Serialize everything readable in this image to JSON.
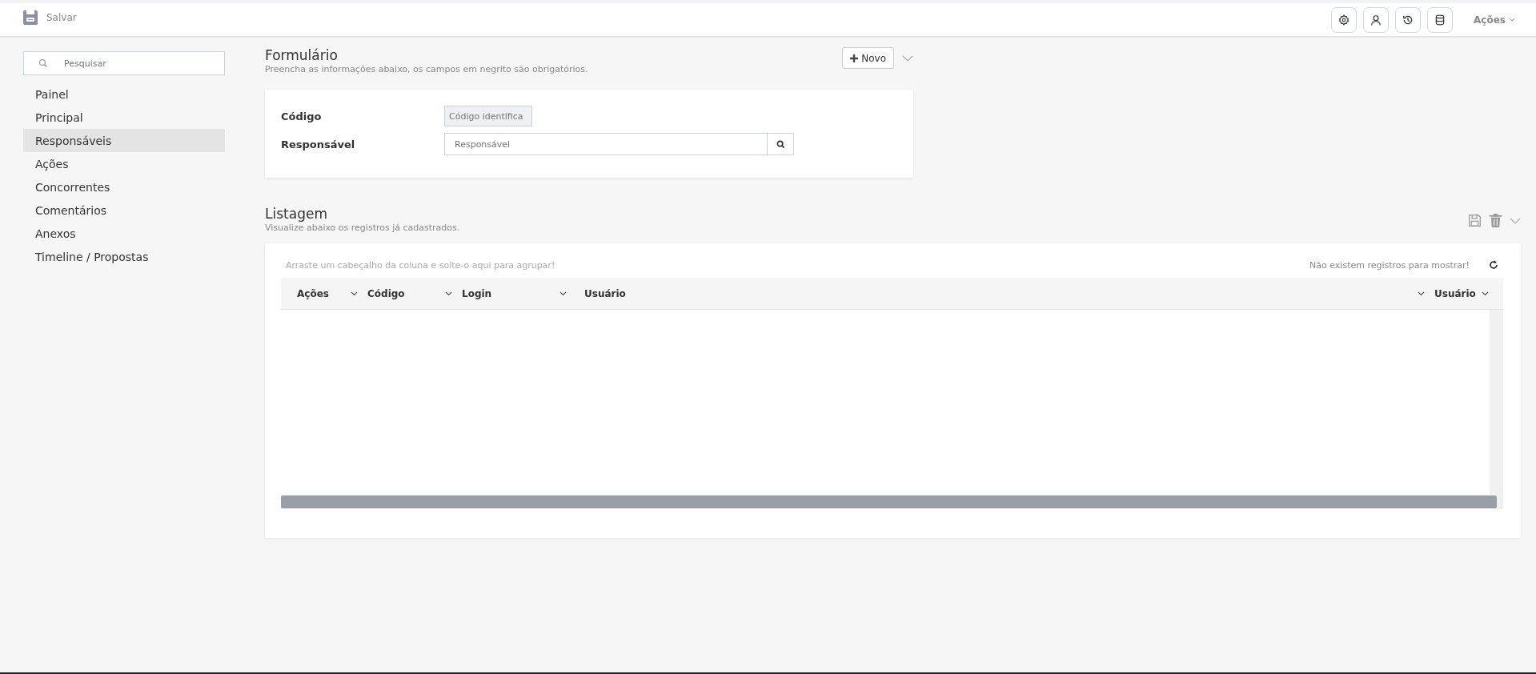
{
  "toolbar": {
    "save_label": "Salvar",
    "actions_label": "Ações"
  },
  "sidebar": {
    "search": {
      "placeholder": "Pesquisar"
    },
    "items": [
      {
        "label": "Painel",
        "selected": false
      },
      {
        "label": "Principal",
        "selected": false
      },
      {
        "label": "Responsáveis",
        "selected": true
      },
      {
        "label": "Ações",
        "selected": false
      },
      {
        "label": "Concorrentes",
        "selected": false
      },
      {
        "label": "Comentários",
        "selected": false
      },
      {
        "label": "Anexos",
        "selected": false
      },
      {
        "label": "Timeline / Propostas",
        "selected": false
      }
    ]
  },
  "form": {
    "title": "Formulário",
    "subtitle": "Preencha as informações abaixo, os campos em negrito são obrigatórios.",
    "new_button": "Novo",
    "fields": [
      {
        "label": "Código",
        "kind": "readonly",
        "placeholder": "Código identifica"
      },
      {
        "label": "Responsável",
        "kind": "lookup",
        "placeholder": "Responsável"
      }
    ]
  },
  "listing": {
    "title": "Listagem",
    "subtitle": "Visualize abaixo os registros já cadastrados.",
    "group_hint": "Arraste um cabeçalho da coluna e solte-o aqui para agrupar!",
    "empty_message": "Não existem registros para mostrar!",
    "columns": [
      {
        "label": "Ações",
        "kind": "actions"
      },
      {
        "label": "Código",
        "kind": "normal"
      },
      {
        "label": "Login",
        "kind": "normal"
      },
      {
        "label": "Usuário",
        "kind": "wide"
      },
      {
        "label": "Usuário",
        "kind": "end"
      }
    ]
  }
}
